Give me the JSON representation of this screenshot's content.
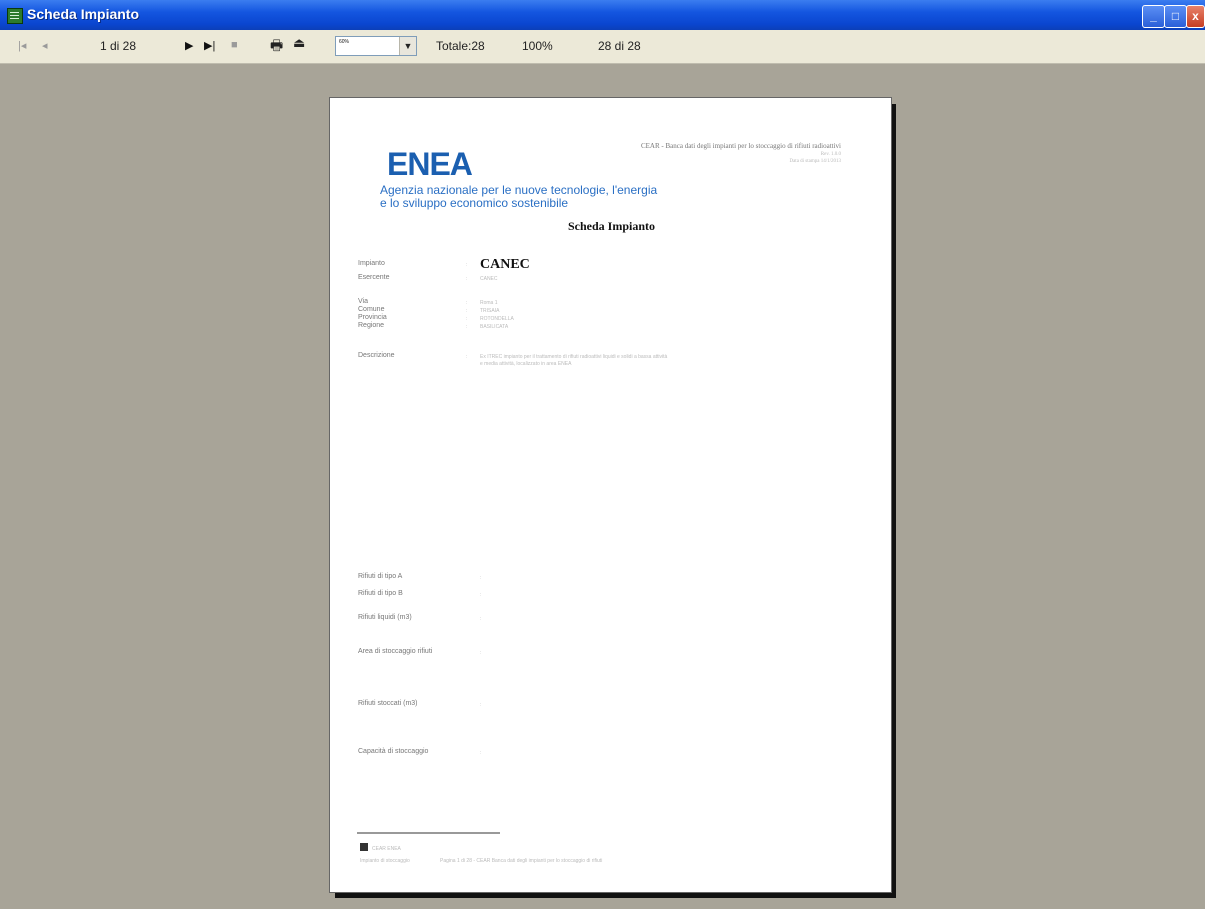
{
  "window": {
    "title": "Scheda Impianto",
    "minimize": "_",
    "maximize": "□",
    "close": "x"
  },
  "toolbar": {
    "first": "|◂",
    "prev": "◂",
    "page_indicator": "1 di 28",
    "next": "▶",
    "last": "▶|",
    "stop": "■",
    "print_icon": "print-icon",
    "export_icon": "export-icon",
    "zoom": "60%",
    "total": "Totale:28",
    "percent": "100%",
    "of_pages": "28 di 28"
  },
  "doc": {
    "logo_text": "ENEA",
    "agency_line1": "Agenzia nazionale per le nuove tecnologie, l'energia",
    "agency_line2": "e lo sviluppo economico sostenibile",
    "header_right_line1": "CEAR - Banca dati degli impianti per lo stoccaggio di rifiuti radioattivi",
    "header_right_line2": "Rev. 1.0.0",
    "header_right_line3": "Data di stampa 14/1/2013",
    "title": "Scheda Impianto",
    "plant_label": "Impianto",
    "plant_name": "CANEC",
    "fields": [
      {
        "label": "Esercente",
        "value": "CANEC"
      },
      {
        "label": "Via",
        "value": "Roma 1"
      },
      {
        "label": "Comune",
        "value": "TRISAIA"
      },
      {
        "label": "Provincia",
        "value": "ROTONDELLA"
      },
      {
        "label": "Regione",
        "value": "BASILICATA"
      }
    ],
    "description_label": "Descrizione",
    "description_line1": "Ex ITREC impianto per il trattamento di rifiuti radioattivi liquidi e solidi a bassa attività",
    "description_line2": "e media attività, localizzato in area ENEA",
    "lower_fields": [
      "Rifiuti di tipo A",
      "Rifiuti di tipo B",
      "Rifiuti liquidi (m3)",
      "Area di stoccaggio rifiuti",
      "Rifiuti stoccati (m3)",
      "Capacità di stoccaggio"
    ],
    "footer_left": "CEAR ENEA",
    "footer_mid": "Impianto di stoccaggio",
    "footer_bottom": "Pagina 1 di 28  -  CEAR  Banca dati degli impianti per lo stoccaggio di rifiuti"
  }
}
